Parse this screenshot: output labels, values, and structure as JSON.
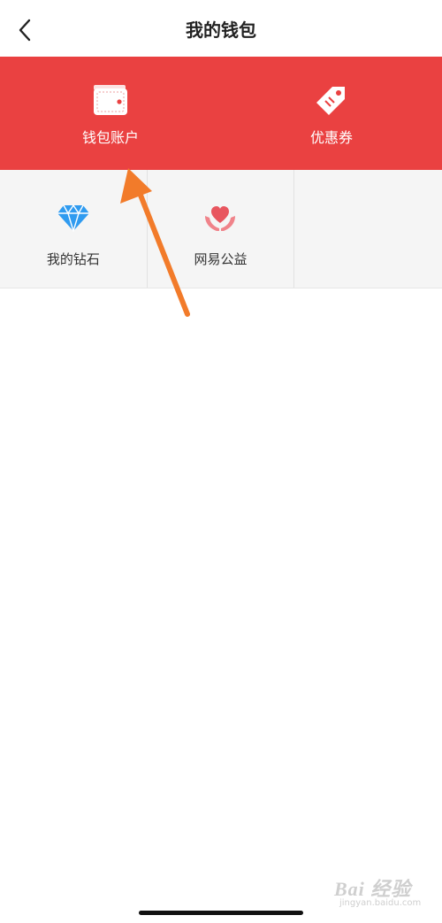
{
  "nav": {
    "title": "我的钱包",
    "back_icon": "chevron-left-icon"
  },
  "banner": {
    "background": "#ea4141",
    "items": [
      {
        "label": "钱包账户",
        "icon": "wallet-icon"
      },
      {
        "label": "优惠券",
        "icon": "price-tag-icon"
      }
    ]
  },
  "grid": {
    "background": "#f5f5f5",
    "items": [
      {
        "label": "我的钻石",
        "icon": "diamond-icon",
        "icon_color": "#2f9bf0"
      },
      {
        "label": "网易公益",
        "icon": "heart-hands-icon",
        "icon_color": "#e8565f"
      },
      {
        "label": ""
      }
    ]
  },
  "annotation": {
    "arrow_color": "#f27b2a"
  },
  "watermark": {
    "logo": "Bai 经验",
    "url": "jingyan.baidu.com"
  }
}
